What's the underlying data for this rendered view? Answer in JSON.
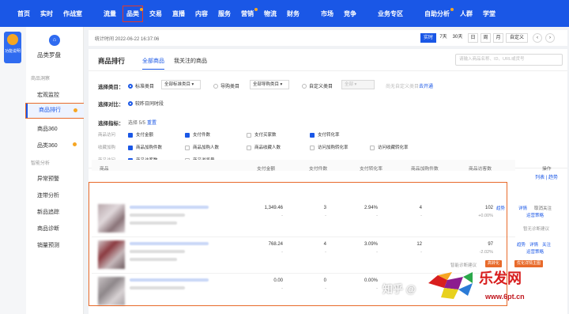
{
  "topnav": {
    "items": [
      "首页",
      "实时",
      "作战室",
      "流量",
      "品类",
      "交易",
      "直播",
      "内容",
      "服务",
      "营销",
      "物流",
      "财务",
      "市场",
      "竞争",
      "业务专区",
      "自助分析",
      "人群",
      "学堂"
    ]
  },
  "func_badge": {
    "label": "功能说明"
  },
  "sidebar": {
    "title": "品类罗盘",
    "group1": "商品洞察",
    "items1": [
      "宏观监控",
      "商品排行",
      "商品360",
      "品类360"
    ],
    "group2": "智能分析",
    "items2": [
      "异常预警",
      "连带分析",
      "新品追踪",
      "商品诊断",
      "销量预测"
    ]
  },
  "statbar": {
    "time": "统计时间 2022-06-22 16:37:06",
    "periods": [
      "实时",
      "7天",
      "30天",
      "日",
      "周",
      "月",
      "自定义"
    ],
    "nav_prev": "‹",
    "nav_next": "›"
  },
  "card": {
    "title": "商品排行",
    "tabs": [
      "全部商品",
      "我关注的商品"
    ],
    "search_placeholder": "请输入商品名称、ID、URL或货号"
  },
  "filters": {
    "category_label": "选择类目：",
    "std_radio": "标准类目",
    "std_select": "全部标准类目",
    "guide_radio": "导购类目",
    "guide_select": "全部导购类目",
    "custom_radio": "自定义类目",
    "custom_select": "全部",
    "custom_hint": "尚无自定义类目",
    "custom_link": "去开通",
    "compare_label": "选择对比：",
    "compare_opt": "较昨日同时段",
    "metric_label": "选择指标：",
    "metric_count": "选择 5/5",
    "metric_reset": "重置"
  },
  "metrics": {
    "groups": [
      "商品访问",
      "收藏加购",
      "商品访问"
    ],
    "row1": [
      {
        "label": "支付金额",
        "on": true
      },
      {
        "label": "支付件数",
        "on": true
      },
      {
        "label": "支付买家数",
        "on": false
      },
      {
        "label": "支付转化率",
        "on": true
      }
    ],
    "row2": [
      {
        "label": "商品加购件数",
        "on": true
      },
      {
        "label": "商品加购人数",
        "on": false
      },
      {
        "label": "商品收藏人数",
        "on": false
      },
      {
        "label": "访问加购转化率",
        "on": false
      },
      {
        "label": "访问收藏转化率",
        "on": false
      }
    ],
    "row3": [
      {
        "label": "商品访客数",
        "on": true
      },
      {
        "label": "商品浏览量",
        "on": false
      }
    ]
  },
  "view_toggle": "列表 | 趋势",
  "table": {
    "headers": [
      "商品",
      "支付金额",
      "支付件数",
      "支付转化率",
      "商品加购件数",
      "商品访客数",
      "操作"
    ],
    "rows": [
      {
        "pay_amount": "1,349.46",
        "pay_amount_sub": "-",
        "pay_qty": "3",
        "pay_qty_sub": "-",
        "cvr": "2.94%",
        "cvr_sub": "-",
        "cart": "4",
        "cart_sub": "-",
        "visitors": "102",
        "visitors_sub": "+0.00%",
        "ops": [
          "趋势",
          "详情",
          "取消关注"
        ],
        "ops2": "运营策略",
        "note": "暂无诊断建议"
      },
      {
        "pay_amount": "768.24",
        "pay_amount_sub": "-",
        "pay_qty": "4",
        "pay_qty_sub": "-",
        "cvr": "3.09%",
        "cvr_sub": "-",
        "cart": "12",
        "cart_sub": "-",
        "visitors": "97",
        "visitors_sub": "-2.02%",
        "ops": [
          "趋势",
          "详情",
          "关注"
        ],
        "ops2": "运营策略",
        "note": "智能诊断建议",
        "tags": [
          "高转化",
          "优化详情主图"
        ]
      },
      {
        "pay_amount": "0.00",
        "pay_amount_sub": "-",
        "pay_qty": "0",
        "pay_qty_sub": "-",
        "cvr": "0.00%",
        "cvr_sub": "-",
        "cart": "",
        "cart_sub": "",
        "visitors": "",
        "visitors_sub": "",
        "ops": [],
        "ops2": "",
        "note": ""
      }
    ]
  },
  "watermark": {
    "zhihu": "知乎 @",
    "brand": "乐发网",
    "url": "www.6pt.cn"
  }
}
